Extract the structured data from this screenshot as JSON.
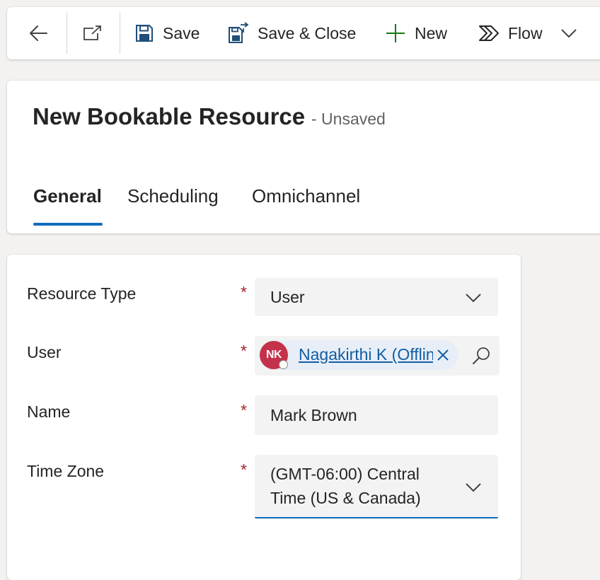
{
  "command_bar": {
    "save_label": "Save",
    "save_close_label": "Save & Close",
    "new_label": "New",
    "flow_label": "Flow"
  },
  "header": {
    "title": "New Bookable Resource",
    "status": "- Unsaved"
  },
  "tabs": [
    {
      "label": "General",
      "active": true
    },
    {
      "label": "Scheduling",
      "active": false
    },
    {
      "label": "Omnichannel",
      "active": false
    }
  ],
  "form": {
    "resource_type": {
      "label": "Resource Type",
      "value": "User"
    },
    "user": {
      "label": "User",
      "initials": "NK",
      "value": "Nagakirthi K (Offline)"
    },
    "name": {
      "label": "Name",
      "value": "Mark Brown"
    },
    "time_zone": {
      "label": "Time Zone",
      "value_line1": "(GMT-06:00) Central",
      "value_line2": "Time (US & Canada)"
    },
    "required_marker": "*"
  },
  "colors": {
    "accent": "#0f6cbd",
    "required": "#a4262c",
    "avatar": "#c4314b",
    "link": "#115ea3",
    "new_icon": "#107c10"
  }
}
